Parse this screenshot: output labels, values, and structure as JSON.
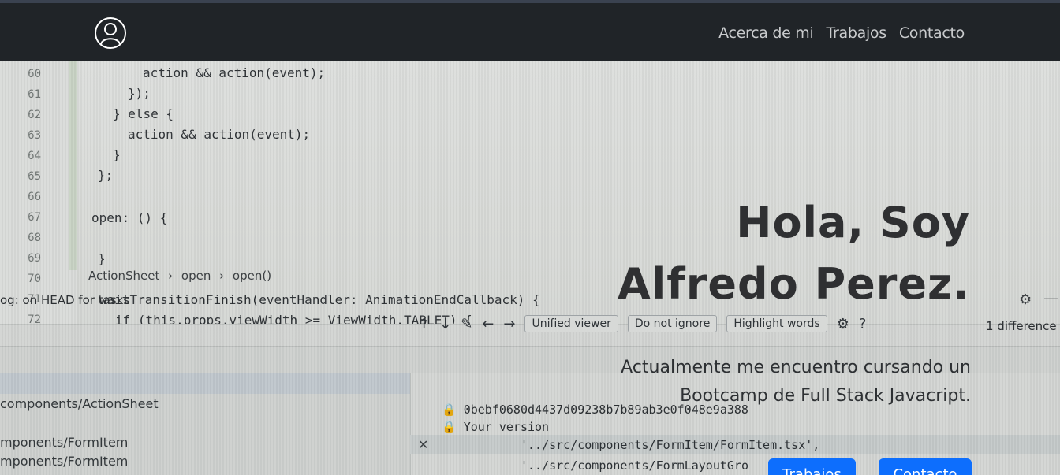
{
  "navbar": {
    "brand_icon": "user-circle-icon",
    "links": [
      "Acerca de mi",
      "Trabajos",
      "Contacto"
    ]
  },
  "hero": {
    "title_line1": "Hola, Soy",
    "title_line2": "Alfredo Perez.",
    "subtitle": "Actualmente me encuentro cursando un Bootcamp de Full Stack Javacript.",
    "buttons": [
      "Trabajos",
      "Contacto"
    ],
    "accent_color": "#0d6efd"
  },
  "background_photo": {
    "line_numbers": [
      "60",
      "61",
      "62",
      "63",
      "64",
      "65",
      "66",
      "67",
      "68",
      "69",
      "70",
      "71",
      "72"
    ],
    "code_lines": [
      "action && action(event);",
      "});",
      "} else {",
      "action && action(event);",
      "}",
      "};",
      "",
      "open: () {",
      "",
      "}",
      "",
      "waitTransitionFinish(eventHandler: AnimationEndCallback) {",
      "if (this.props.viewWidth >= ViewWidth.TABLET) {"
    ],
    "breadcrumbs": [
      "ActionSheet",
      "open",
      "open()"
    ],
    "log_title": "og: on HEAD for tasks",
    "left_items": [
      "components/ActionSheet",
      "mponents/FormItem",
      "mponents/FormItem"
    ],
    "diff_viewer": "Unified viewer",
    "ignore_option": "Do not ignore",
    "highlight_option": "Highlight words",
    "difference_count": "1 difference",
    "hash": "0bebf0680d4437d09238b7b89ab3e0f048e9a388",
    "your_version": "Your version",
    "diff_lines": [
      "'../src/components/FormItem/FormItem.tsx',",
      "'../src/components/FormLayoutGro"
    ]
  }
}
